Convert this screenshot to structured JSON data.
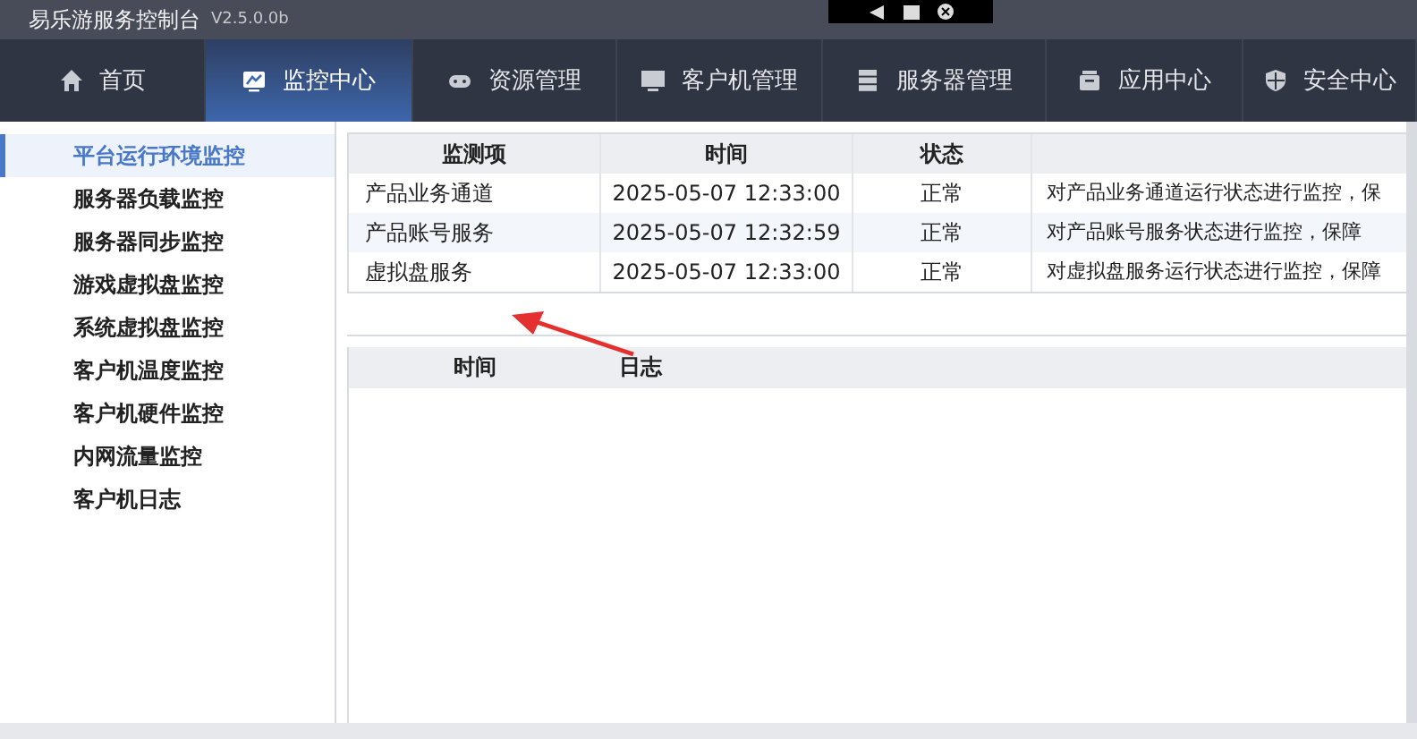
{
  "window": {
    "title": "易乐游服务控制台",
    "version": "V2.5.0.0b"
  },
  "nav_tabs": [
    {
      "label": "首页",
      "selected": false
    },
    {
      "label": "监控中心",
      "selected": true
    },
    {
      "label": "资源管理",
      "selected": false
    },
    {
      "label": "客户机管理",
      "selected": false
    },
    {
      "label": "服务器管理",
      "selected": false
    },
    {
      "label": "应用中心",
      "selected": false
    },
    {
      "label": "安全中心",
      "selected": false
    }
  ],
  "sidebar": {
    "items": [
      {
        "label": "平台运行环境监控",
        "selected": true
      },
      {
        "label": "服务器负载监控",
        "selected": false
      },
      {
        "label": "服务器同步监控",
        "selected": false
      },
      {
        "label": "游戏虚拟盘监控",
        "selected": false
      },
      {
        "label": "系统虚拟盘监控",
        "selected": false
      },
      {
        "label": "客户机温度监控",
        "selected": false
      },
      {
        "label": "客户机硬件监控",
        "selected": false
      },
      {
        "label": "内网流量监控",
        "selected": false
      },
      {
        "label": "客户机日志",
        "selected": false
      }
    ]
  },
  "monitor_table": {
    "columns": [
      "监测项",
      "时间",
      "状态"
    ],
    "rows": [
      {
        "item": "产品业务通道",
        "time": "2025-05-07 12:33:00",
        "status": "正常",
        "description": "对产品业务通道运行状态进行监控，保"
      },
      {
        "item": "产品账号服务",
        "time": "2025-05-07 12:32:59",
        "status": "正常",
        "description": "对产品账号服务状态进行监控，保障"
      },
      {
        "item": "虚拟盘服务",
        "time": "2025-05-07 12:33:00",
        "status": "正常",
        "description": "对虚拟盘服务运行状态进行监控，保障"
      }
    ]
  },
  "log_table": {
    "columns": [
      "时间",
      "日志"
    ]
  }
}
